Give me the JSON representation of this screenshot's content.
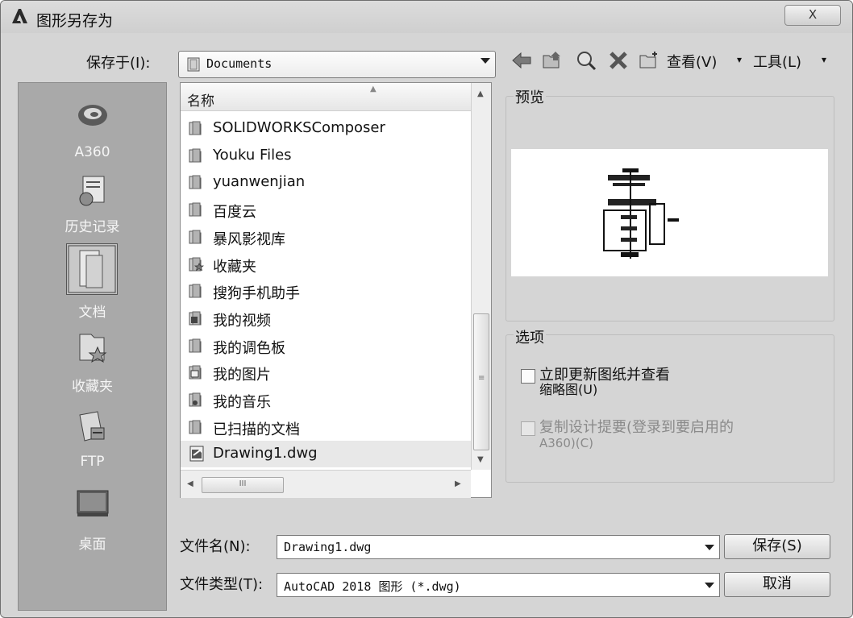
{
  "window": {
    "title": "图形另存为",
    "close_label": "X"
  },
  "save_in": {
    "label": "保存于(I):",
    "value": "Documents"
  },
  "toolbar": {
    "view_label": "查看(V)",
    "tools_label": "工具(L)"
  },
  "places": [
    {
      "label": "A360",
      "icon": "cloud-icon"
    },
    {
      "label": "历史记录",
      "icon": "history-icon"
    },
    {
      "label": "文档",
      "icon": "documents-icon"
    },
    {
      "label": "收藏夹",
      "icon": "favorites-icon"
    },
    {
      "label": "FTP",
      "icon": "ftp-icon"
    },
    {
      "label": "桌面",
      "icon": "desktop-icon"
    }
  ],
  "file_list": {
    "column_name": "名称",
    "items": [
      {
        "name": "SOLIDWORKSComposer",
        "icon": "folder-icon"
      },
      {
        "name": "Youku Files",
        "icon": "folder-icon"
      },
      {
        "name": "yuanwenjian",
        "icon": "folder-icon"
      },
      {
        "name": "百度云",
        "icon": "folder-icon"
      },
      {
        "name": "暴风影视库",
        "icon": "folder-icon"
      },
      {
        "name": "收藏夹",
        "icon": "favorites-folder-icon"
      },
      {
        "name": "搜狗手机助手",
        "icon": "folder-icon"
      },
      {
        "name": "我的视频",
        "icon": "video-folder-icon"
      },
      {
        "name": "我的调色板",
        "icon": "folder-icon"
      },
      {
        "name": "我的图片",
        "icon": "picture-folder-icon"
      },
      {
        "name": "我的音乐",
        "icon": "music-folder-icon"
      },
      {
        "name": "已扫描的文档",
        "icon": "folder-icon"
      },
      {
        "name": "Drawing1.dwg",
        "icon": "dwg-file-icon"
      }
    ]
  },
  "preview": {
    "label": "预览"
  },
  "options": {
    "label": "选项",
    "update_thumbnail": {
      "line1": "立即更新图纸并查看",
      "line2": "缩略图(U)",
      "checked": false
    },
    "copy_design_feed": {
      "line1": "复制设计提要(登录到要启用的",
      "line2": "A360)(C)",
      "checked": false,
      "enabled": false
    }
  },
  "filename": {
    "label": "文件名(N):",
    "value": "Drawing1.dwg"
  },
  "filetype": {
    "label": "文件类型(T):",
    "value": "AutoCAD 2018 图形 (*.dwg)"
  },
  "buttons": {
    "save": "保存(S)",
    "cancel": "取消"
  },
  "scroll": {
    "hthumb_grip": "III",
    "vthumb_grip": "≡"
  },
  "colors": {
    "places_bg": "#a9a9a9",
    "dialog_bg": "#d5d5d5"
  }
}
